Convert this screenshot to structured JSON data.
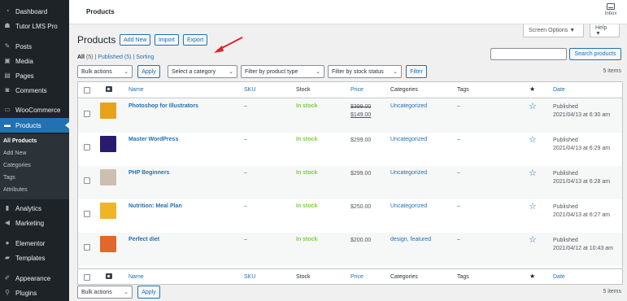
{
  "sidebar": {
    "items": [
      {
        "label": "Dashboard",
        "icon": "dashboard-icon"
      },
      {
        "label": "Tutor LMS Pro",
        "icon": "tutor-icon"
      },
      {
        "label": "Posts",
        "icon": "pin-icon"
      },
      {
        "label": "Media",
        "icon": "media-icon"
      },
      {
        "label": "Pages",
        "icon": "pages-icon"
      },
      {
        "label": "Comments",
        "icon": "comments-icon"
      },
      {
        "label": "WooCommerce",
        "icon": "woocommerce-icon"
      },
      {
        "label": "Products",
        "icon": "products-icon"
      },
      {
        "label": "Analytics",
        "icon": "analytics-icon"
      },
      {
        "label": "Marketing",
        "icon": "marketing-icon"
      },
      {
        "label": "Elementor",
        "icon": "elementor-icon"
      },
      {
        "label": "Templates",
        "icon": "templates-icon"
      },
      {
        "label": "Appearance",
        "icon": "appearance-icon"
      },
      {
        "label": "Plugins",
        "icon": "plugins-icon"
      }
    ],
    "submenu": [
      "All Products",
      "Add New",
      "Categories",
      "Tags",
      "Attributes"
    ],
    "active_color": "#2271b1"
  },
  "header": {
    "title": "Products",
    "inbox_label": "Inbox"
  },
  "main": {
    "page_title": "Products",
    "add_new": "Add New",
    "import": "Import",
    "export": "Export",
    "screen_options": "Screen Options ▼",
    "help": "Help ▼",
    "views": {
      "all": "All",
      "all_count": "(5)",
      "published": "Published (5)",
      "sorting": "Sorting",
      "sep": "|"
    },
    "search_button": "Search products",
    "search_value": "",
    "bulk_actions": "Bulk actions",
    "apply": "Apply",
    "category_filter": "Select a category",
    "type_filter": "Filter by product type",
    "stock_filter": "Filter by stock status",
    "filter_button": "Filter",
    "items_count": "5 items"
  },
  "table": {
    "columns": {
      "name": "Name",
      "sku": "SKU",
      "stock": "Stock",
      "price": "Price",
      "categories": "Categories",
      "tags": "Tags",
      "featured": "★",
      "date": "Date"
    },
    "rows": [
      {
        "name": "Photoshop for Illustrators",
        "sku": "–",
        "stock": "In stock",
        "price_old": "$399.00",
        "price": "$149.00",
        "categories": "Uncategorized",
        "tags": "–",
        "date_status": "Published",
        "date": "2021/04/13 at 6:30 am",
        "thumb_color": "#e8a21b"
      },
      {
        "name": "Master WordPress",
        "sku": "–",
        "stock": "In stock",
        "price_old": "",
        "price": "$299.00",
        "categories": "Uncategorized",
        "tags": "–",
        "date_status": "Published",
        "date": "2021/04/13 at 6:29 am",
        "thumb_color": "#2a1b6e"
      },
      {
        "name": "PHP Beginners",
        "sku": "–",
        "stock": "In stock",
        "price_old": "",
        "price": "$299.00",
        "categories": "Uncategorized",
        "tags": "–",
        "date_status": "Published",
        "date": "2021/04/13 at 6:28 am",
        "thumb_color": "#cbbfb2"
      },
      {
        "name": "Nutrition: Meal Plan",
        "sku": "–",
        "stock": "In stock",
        "price_old": "",
        "price": "$250.00",
        "categories": "Uncategorized",
        "tags": "–",
        "date_status": "Published",
        "date": "2021/04/13 at 6:27 am",
        "thumb_color": "#f0b429"
      },
      {
        "name": "Perfect diet",
        "sku": "–",
        "stock": "In stock",
        "price_old": "",
        "price": "$200.00",
        "categories": "design, featured",
        "tags": "–",
        "date_status": "Published",
        "date": "2021/04/12 at 10:43 am",
        "thumb_color": "#e3672a"
      }
    ]
  },
  "footer": {
    "bulk_actions": "Bulk actions",
    "apply": "Apply",
    "items_count": "5 items"
  },
  "annotation": {
    "arrow_color": "#e02424"
  }
}
